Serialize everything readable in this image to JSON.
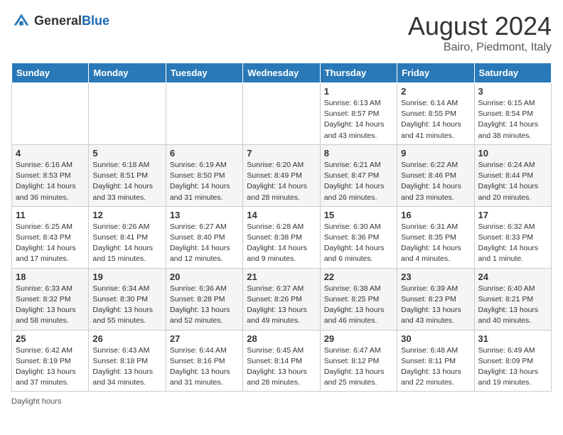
{
  "header": {
    "logo_general": "General",
    "logo_blue": "Blue",
    "month_year": "August 2024",
    "location": "Bairo, Piedmont, Italy"
  },
  "days_of_week": [
    "Sunday",
    "Monday",
    "Tuesday",
    "Wednesday",
    "Thursday",
    "Friday",
    "Saturday"
  ],
  "weeks": [
    [
      {
        "day": "",
        "sunrise": "",
        "sunset": "",
        "daylight": ""
      },
      {
        "day": "",
        "sunrise": "",
        "sunset": "",
        "daylight": ""
      },
      {
        "day": "",
        "sunrise": "",
        "sunset": "",
        "daylight": ""
      },
      {
        "day": "",
        "sunrise": "",
        "sunset": "",
        "daylight": ""
      },
      {
        "day": "1",
        "sunrise": "Sunrise: 6:13 AM",
        "sunset": "Sunset: 8:57 PM",
        "daylight": "Daylight: 14 hours and 43 minutes."
      },
      {
        "day": "2",
        "sunrise": "Sunrise: 6:14 AM",
        "sunset": "Sunset: 8:55 PM",
        "daylight": "Daylight: 14 hours and 41 minutes."
      },
      {
        "day": "3",
        "sunrise": "Sunrise: 6:15 AM",
        "sunset": "Sunset: 8:54 PM",
        "daylight": "Daylight: 14 hours and 38 minutes."
      }
    ],
    [
      {
        "day": "4",
        "sunrise": "Sunrise: 6:16 AM",
        "sunset": "Sunset: 8:53 PM",
        "daylight": "Daylight: 14 hours and 36 minutes."
      },
      {
        "day": "5",
        "sunrise": "Sunrise: 6:18 AM",
        "sunset": "Sunset: 8:51 PM",
        "daylight": "Daylight: 14 hours and 33 minutes."
      },
      {
        "day": "6",
        "sunrise": "Sunrise: 6:19 AM",
        "sunset": "Sunset: 8:50 PM",
        "daylight": "Daylight: 14 hours and 31 minutes."
      },
      {
        "day": "7",
        "sunrise": "Sunrise: 6:20 AM",
        "sunset": "Sunset: 8:49 PM",
        "daylight": "Daylight: 14 hours and 28 minutes."
      },
      {
        "day": "8",
        "sunrise": "Sunrise: 6:21 AM",
        "sunset": "Sunset: 8:47 PM",
        "daylight": "Daylight: 14 hours and 26 minutes."
      },
      {
        "day": "9",
        "sunrise": "Sunrise: 6:22 AM",
        "sunset": "Sunset: 8:46 PM",
        "daylight": "Daylight: 14 hours and 23 minutes."
      },
      {
        "day": "10",
        "sunrise": "Sunrise: 6:24 AM",
        "sunset": "Sunset: 8:44 PM",
        "daylight": "Daylight: 14 hours and 20 minutes."
      }
    ],
    [
      {
        "day": "11",
        "sunrise": "Sunrise: 6:25 AM",
        "sunset": "Sunset: 8:43 PM",
        "daylight": "Daylight: 14 hours and 17 minutes."
      },
      {
        "day": "12",
        "sunrise": "Sunrise: 6:26 AM",
        "sunset": "Sunset: 8:41 PM",
        "daylight": "Daylight: 14 hours and 15 minutes."
      },
      {
        "day": "13",
        "sunrise": "Sunrise: 6:27 AM",
        "sunset": "Sunset: 8:40 PM",
        "daylight": "Daylight: 14 hours and 12 minutes."
      },
      {
        "day": "14",
        "sunrise": "Sunrise: 6:28 AM",
        "sunset": "Sunset: 8:38 PM",
        "daylight": "Daylight: 14 hours and 9 minutes."
      },
      {
        "day": "15",
        "sunrise": "Sunrise: 6:30 AM",
        "sunset": "Sunset: 8:36 PM",
        "daylight": "Daylight: 14 hours and 6 minutes."
      },
      {
        "day": "16",
        "sunrise": "Sunrise: 6:31 AM",
        "sunset": "Sunset: 8:35 PM",
        "daylight": "Daylight: 14 hours and 4 minutes."
      },
      {
        "day": "17",
        "sunrise": "Sunrise: 6:32 AM",
        "sunset": "Sunset: 8:33 PM",
        "daylight": "Daylight: 14 hours and 1 minute."
      }
    ],
    [
      {
        "day": "18",
        "sunrise": "Sunrise: 6:33 AM",
        "sunset": "Sunset: 8:32 PM",
        "daylight": "Daylight: 13 hours and 58 minutes."
      },
      {
        "day": "19",
        "sunrise": "Sunrise: 6:34 AM",
        "sunset": "Sunset: 8:30 PM",
        "daylight": "Daylight: 13 hours and 55 minutes."
      },
      {
        "day": "20",
        "sunrise": "Sunrise: 6:36 AM",
        "sunset": "Sunset: 8:28 PM",
        "daylight": "Daylight: 13 hours and 52 minutes."
      },
      {
        "day": "21",
        "sunrise": "Sunrise: 6:37 AM",
        "sunset": "Sunset: 8:26 PM",
        "daylight": "Daylight: 13 hours and 49 minutes."
      },
      {
        "day": "22",
        "sunrise": "Sunrise: 6:38 AM",
        "sunset": "Sunset: 8:25 PM",
        "daylight": "Daylight: 13 hours and 46 minutes."
      },
      {
        "day": "23",
        "sunrise": "Sunrise: 6:39 AM",
        "sunset": "Sunset: 8:23 PM",
        "daylight": "Daylight: 13 hours and 43 minutes."
      },
      {
        "day": "24",
        "sunrise": "Sunrise: 6:40 AM",
        "sunset": "Sunset: 8:21 PM",
        "daylight": "Daylight: 13 hours and 40 minutes."
      }
    ],
    [
      {
        "day": "25",
        "sunrise": "Sunrise: 6:42 AM",
        "sunset": "Sunset: 8:19 PM",
        "daylight": "Daylight: 13 hours and 37 minutes."
      },
      {
        "day": "26",
        "sunrise": "Sunrise: 6:43 AM",
        "sunset": "Sunset: 8:18 PM",
        "daylight": "Daylight: 13 hours and 34 minutes."
      },
      {
        "day": "27",
        "sunrise": "Sunrise: 6:44 AM",
        "sunset": "Sunset: 8:16 PM",
        "daylight": "Daylight: 13 hours and 31 minutes."
      },
      {
        "day": "28",
        "sunrise": "Sunrise: 6:45 AM",
        "sunset": "Sunset: 8:14 PM",
        "daylight": "Daylight: 13 hours and 28 minutes."
      },
      {
        "day": "29",
        "sunrise": "Sunrise: 6:47 AM",
        "sunset": "Sunset: 8:12 PM",
        "daylight": "Daylight: 13 hours and 25 minutes."
      },
      {
        "day": "30",
        "sunrise": "Sunrise: 6:48 AM",
        "sunset": "Sunset: 8:11 PM",
        "daylight": "Daylight: 13 hours and 22 minutes."
      },
      {
        "day": "31",
        "sunrise": "Sunrise: 6:49 AM",
        "sunset": "Sunset: 8:09 PM",
        "daylight": "Daylight: 13 hours and 19 minutes."
      }
    ]
  ],
  "footer": {
    "daylight_label": "Daylight hours"
  }
}
